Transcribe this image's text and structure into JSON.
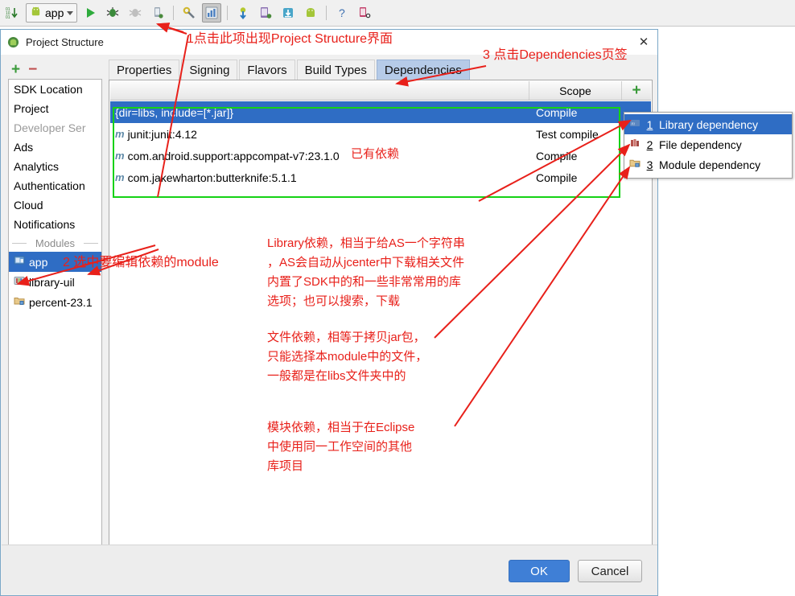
{
  "toolbar": {
    "icons": [
      {
        "name": "binary-counter-icon",
        "glyph": "01"
      },
      {
        "name": "run-icon",
        "glyph": "▶"
      },
      {
        "name": "debug-icon",
        "glyph": "✹"
      },
      {
        "name": "coverage-icon",
        "glyph": "❊"
      },
      {
        "name": "attach-debugger-icon",
        "glyph": "▯"
      },
      {
        "name": "sync-gradle-icon",
        "glyph": "⚒"
      },
      {
        "name": "project-structure-icon",
        "glyph": "▦"
      },
      {
        "name": "sdk-manager-icon",
        "glyph": "⬇"
      },
      {
        "name": "avd-manager-icon",
        "glyph": "▤"
      },
      {
        "name": "android-download-icon",
        "glyph": "⬓"
      },
      {
        "name": "android-device-monitor-icon",
        "glyph": "☗"
      },
      {
        "name": "help-icon",
        "glyph": "?"
      },
      {
        "name": "layout-inspector-icon",
        "glyph": "▥"
      }
    ],
    "module_selector": {
      "label": "app",
      "icon": "android-icon"
    }
  },
  "dialog": {
    "title": "Project Structure",
    "title_icon": "android-studio-icon",
    "close_icon": "close-icon",
    "close_glyph": "✕",
    "add_label": "+",
    "remove_label": "−",
    "sidebar": {
      "items": [
        {
          "label": "SDK Location",
          "disabled": false
        },
        {
          "label": "Project",
          "disabled": false
        },
        {
          "label": "Developer Ser",
          "disabled": true
        },
        {
          "label": "Ads",
          "disabled": false
        },
        {
          "label": "Analytics",
          "disabled": false
        },
        {
          "label": "Authentication",
          "disabled": false
        },
        {
          "label": "Cloud",
          "disabled": false
        },
        {
          "label": "Notifications",
          "disabled": false
        }
      ],
      "separator_label": "Modules",
      "modules": [
        {
          "label": "app",
          "icon": "android-module-icon",
          "selected": true
        },
        {
          "label": "library-uil",
          "icon": "library-module-icon",
          "selected": false
        },
        {
          "label": "percent-23.1",
          "icon": "folder-module-icon",
          "selected": false
        }
      ]
    },
    "tabs": [
      {
        "label": "Properties",
        "selected": false
      },
      {
        "label": "Signing",
        "selected": false
      },
      {
        "label": "Flavors",
        "selected": false
      },
      {
        "label": "Build Types",
        "selected": false
      },
      {
        "label": "Dependencies",
        "selected": true
      }
    ],
    "dependencies_table": {
      "columns": [
        "",
        "Scope"
      ],
      "add_button_label": "+",
      "rows": [
        {
          "marker": "",
          "name": "{dir=libs, include=[*.jar]}",
          "scope": "Compile",
          "selected": true
        },
        {
          "marker": "m",
          "name": "junit:junit:4.12",
          "scope": "Test compile",
          "selected": false
        },
        {
          "marker": "m",
          "name": "com.android.support:appcompat-v7:23.1.0",
          "scope": "Compile",
          "selected": false
        },
        {
          "marker": "m",
          "name": "com.jakewharton:butterknife:5.1.1",
          "scope": "Compile",
          "selected": false
        }
      ]
    },
    "add_menu": {
      "items": [
        {
          "number": "1",
          "label": "Library dependency",
          "icon": "library-icon",
          "selected": true
        },
        {
          "number": "2",
          "label": "File dependency",
          "icon": "file-jar-icon",
          "selected": false
        },
        {
          "number": "3",
          "label": "Module dependency",
          "icon": "module-folder-icon",
          "selected": false
        }
      ]
    },
    "footer": {
      "ok_label": "OK",
      "cancel_label": "Cancel"
    }
  },
  "annotations": {
    "color": "#e8201a",
    "step1": "1点击此项出现Project Structure界面",
    "step3": "3 点击Dependencies页签",
    "step2": "2 选中要编辑依赖的module",
    "existing_deps": "已有依赖",
    "library_note": "Library依赖，相当于给AS一个字符串\n，AS会自动从jcenter中下载相关文件\n内置了SDK中的和一些非常常用的库\n选项；也可以搜索，下载",
    "file_note": "文件依赖，相等于拷贝jar包，\n只能选择本module中的文件，\n一般都是在libs文件夹中的",
    "module_note": "模块依赖，相当于在Eclipse\n中使用同一工作空间的其他\n库项目"
  },
  "colors": {
    "accent_blue": "#2f6dc4",
    "highlight_green": "#15d215",
    "annotation_red": "#e8201a",
    "tab_selected": "#b6cbe8"
  }
}
